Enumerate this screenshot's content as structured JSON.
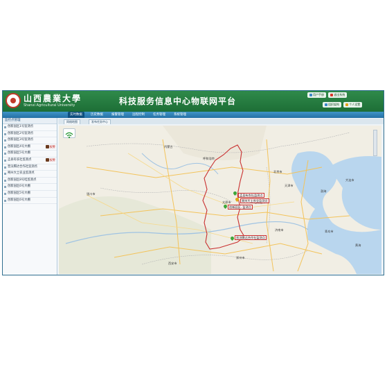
{
  "header": {
    "school_cn": "山西農業大學",
    "school_en": "Shanxi Agricultural University",
    "platform_title": "科技服务信息中心物联网平台",
    "user_links": [
      "用户手册",
      "退出系统",
      "组织架构",
      "个人设置"
    ]
  },
  "nav": {
    "items": [
      "实时数据",
      "历史数据",
      "报警管理",
      "远程控制",
      "任务管理",
      "系统管理"
    ],
    "active_index": 0
  },
  "sidebar": {
    "title": "监控点管理",
    "items": [
      {
        "label": "创新园区1号监测点"
      },
      {
        "label": "创新园区2号监测点"
      },
      {
        "label": "创新园区3号监测点"
      },
      {
        "label": "创新园区4号大棚",
        "alarm": "报警"
      },
      {
        "label": "创新园区5号大棚"
      },
      {
        "label": "孟县有农社监测点",
        "alarm": "报警"
      },
      {
        "label": "晋汾腾达合作社监测点"
      },
      {
        "label": "朔州大土农业监测点"
      },
      {
        "label": "创新园区8号畦监测点"
      },
      {
        "label": "创新园区6号大棚"
      },
      {
        "label": "创新园区5号大棚"
      },
      {
        "label": "创新园区6号大棚"
      }
    ]
  },
  "content": {
    "tabs": [
      "网络地图",
      "发布任务中心"
    ]
  },
  "map": {
    "labels": [
      {
        "name": "内蒙古"
      },
      {
        "name": "呼和浩特"
      },
      {
        "name": "北京市"
      },
      {
        "name": "天津市"
      },
      {
        "name": "石家庄市"
      },
      {
        "name": "济南市"
      },
      {
        "name": "太原市"
      },
      {
        "name": "郑州市"
      },
      {
        "name": "西安市"
      },
      {
        "name": "银川市"
      },
      {
        "name": "渤海"
      },
      {
        "name": "黄海"
      },
      {
        "name": "大连市"
      },
      {
        "name": "青岛市"
      }
    ],
    "stations": [
      {
        "name": "孟县有农社监测点"
      },
      {
        "name": "朔州大土农业监测点"
      },
      {
        "name": "创新园区..监测点"
      },
      {
        "name": "晋汾腾达合作社监测点"
      }
    ]
  },
  "colors": {
    "header_green": "#1d6e36",
    "nav_blue": "#2470a5",
    "province_border": "#c92f2f",
    "alarm_red": "#c0221a"
  }
}
